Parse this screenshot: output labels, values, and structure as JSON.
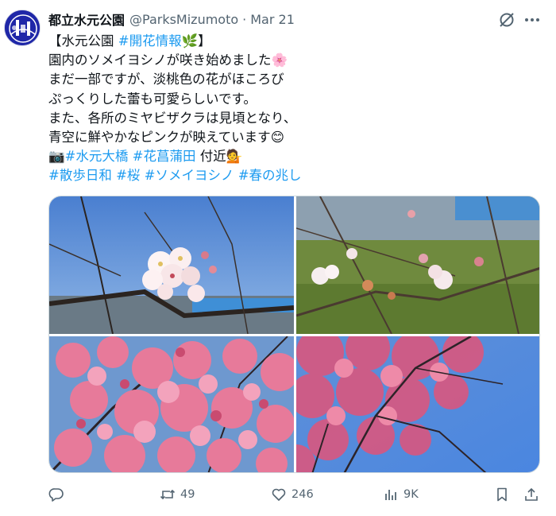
{
  "tweet": {
    "author_name": "都立水元公園",
    "author_handle": "@ParksMizumoto",
    "separator": "·",
    "date": "Mar 21",
    "lines": {
      "l1_open": "【水元公園 ",
      "l1_tag": "#開花情報",
      "l1_close": "】",
      "l2": "園内のソメイヨシノが咲き始めました",
      "l3": "まだ一部ですが、淡桃色の花がほころび",
      "l4": "ぷっくりした蕾も可愛らしいです。",
      "l5": "また、各所のミヤビザクラは見頃となり、",
      "l6": "青空に鮮やかなピンクが映えています",
      "l7_tag1": "#水元大橋",
      "l7_tag2": "#花菖蒲田",
      "l7_text": "付近",
      "l8_tag1": "#散歩日和",
      "l8_tag2": "#桜",
      "l8_tag3": "#ソメイヨシノ",
      "l8_tag4": "#春の兆し"
    },
    "emojis": {
      "herb": "🌿",
      "blossom": "🌸",
      "smile": "😊",
      "camera": "📷",
      "person": "💁"
    },
    "metrics": {
      "retweets": "49",
      "likes": "246",
      "views": "9K"
    },
    "icons": [
      "grok-icon",
      "more-icon",
      "reply-icon",
      "retweet-icon",
      "like-icon",
      "views-icon",
      "bookmark-icon",
      "share-icon"
    ]
  },
  "colors": {
    "text": "#0f1419",
    "secondary": "#536471",
    "link": "#1d9bf0",
    "border": "#cfd9de",
    "avatar_bg": "#1f27a8"
  }
}
